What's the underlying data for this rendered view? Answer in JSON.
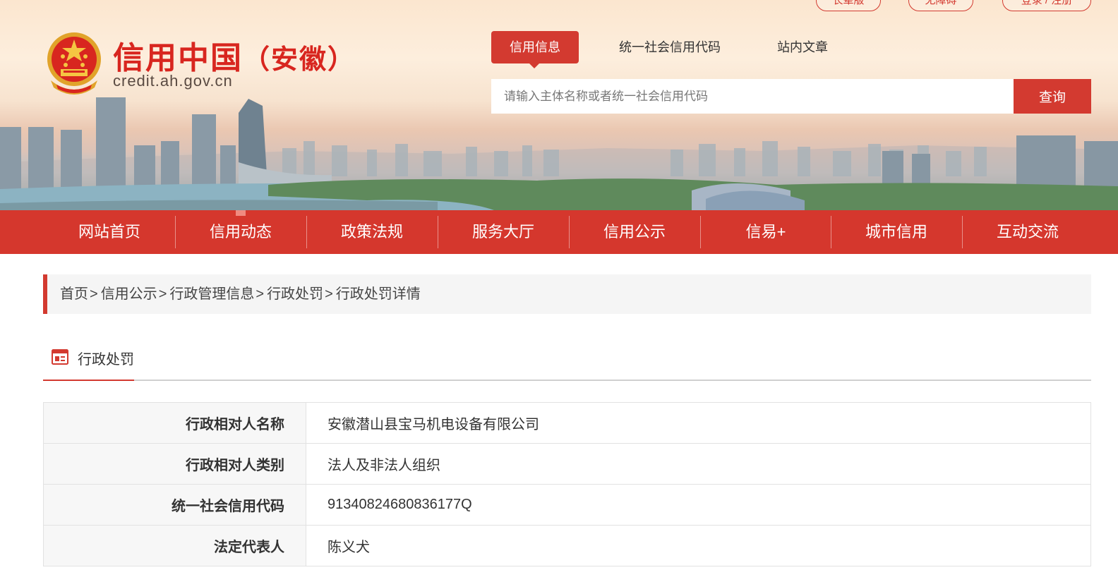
{
  "top_links": [
    "长辈版",
    "无障碍",
    "登录 / 注册"
  ],
  "logo": {
    "title": "信用中国",
    "region_open": "（",
    "region": "安徽",
    "region_close": "）",
    "domain": "credit.ah.gov.cn"
  },
  "search": {
    "tabs": [
      "信用信息",
      "统一社会信用代码",
      "站内文章"
    ],
    "active_tab": 0,
    "placeholder": "请输入主体名称或者统一社会信用代码",
    "value": "",
    "button_label": "查询"
  },
  "nav": {
    "items": [
      "网站首页",
      "信用动态",
      "政策法规",
      "服务大厅",
      "信用公示",
      "信易+",
      "城市信用",
      "互动交流"
    ],
    "active_index": 1
  },
  "breadcrumb": {
    "items": [
      "首页",
      "信用公示",
      "行政管理信息",
      "行政处罚",
      "行政处罚详情"
    ],
    "separator": ">"
  },
  "section": {
    "title": "行政处罚",
    "icon": "document-list-icon"
  },
  "details": [
    {
      "label": "行政相对人名称",
      "value": "安徽潜山县宝马机电设备有限公司"
    },
    {
      "label": "行政相对人类别",
      "value": "法人及非法人组织"
    },
    {
      "label": "统一社会信用代码",
      "value": "91340824680836177Q"
    },
    {
      "label": "法定代表人",
      "value": "陈义犬"
    }
  ],
  "colors": {
    "brand_red": "#d33a30",
    "nav_red": "#d5372d",
    "breadcrumb_bg": "#f5f5f5",
    "label_bg": "#f7f7f7"
  }
}
